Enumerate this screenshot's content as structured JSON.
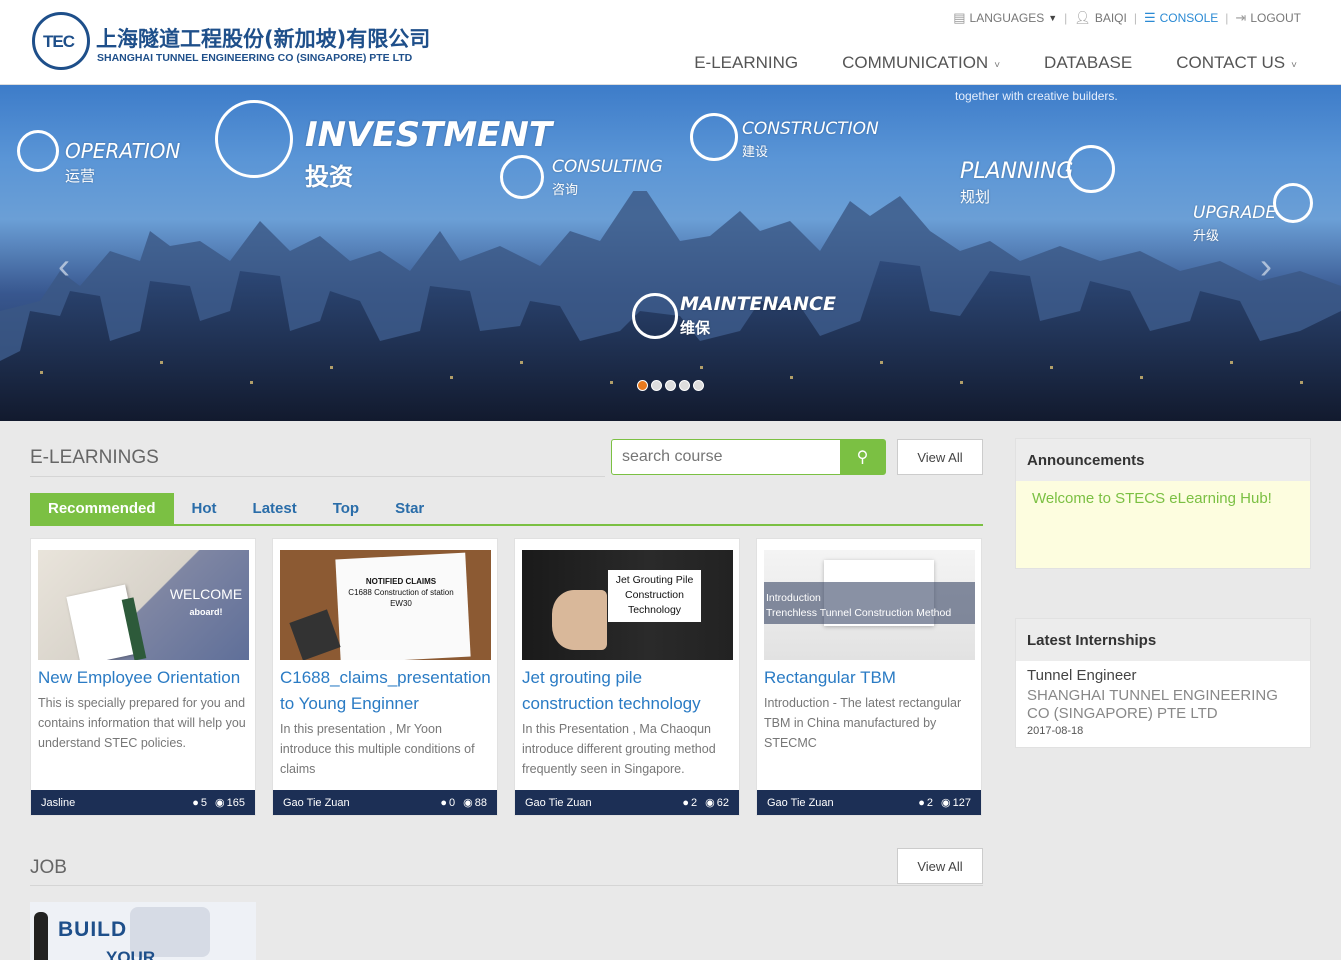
{
  "company": {
    "logo_mark": "TEC",
    "name_cn": "上海隧道工程股份(新加坡)有限公司",
    "name_en": "SHANGHAI TUNNEL ENGINEERING CO (SINGAPORE) PTE LTD"
  },
  "toplinks": {
    "languages": "LANGUAGES",
    "user": "BAIQI",
    "console": "CONSOLE",
    "logout": "LOGOUT"
  },
  "nav": [
    {
      "label": "E-LEARNING",
      "dropdown": false
    },
    {
      "label": "COMMUNICATION",
      "dropdown": true
    },
    {
      "label": "DATABASE",
      "dropdown": false
    },
    {
      "label": "CONTACT US",
      "dropdown": true
    }
  ],
  "hero": {
    "tagline": "together with creative builders.",
    "words": [
      {
        "en": "OPERATION",
        "cn": "运营"
      },
      {
        "en": "INVESTMENT",
        "cn": "投资"
      },
      {
        "en": "CONSULTING",
        "cn": "咨询"
      },
      {
        "en": "CONSTRUCTION",
        "cn": "建设"
      },
      {
        "en": "PLANNING",
        "cn": "规划"
      },
      {
        "en": "UPGRADE",
        "cn": "升级"
      },
      {
        "en": "MAINTENANCE",
        "cn": "维保"
      }
    ],
    "slide_count": 5,
    "active_slide": 1
  },
  "elearnings": {
    "title": "E-LEARNINGS",
    "search_placeholder": "search course",
    "view_all": "View All",
    "tabs": [
      "Recommended",
      "Hot",
      "Latest",
      "Top",
      "Star"
    ],
    "active_tab": "Recommended",
    "courses": [
      {
        "title": "New Employee Orientation",
        "thumb_text": "WELCOME",
        "thumb_sub": "aboard!",
        "description": "This is specially prepared for you and contains information that will help you understand STEC policies.",
        "author": "Jasline",
        "learners": "5",
        "views": "165"
      },
      {
        "title": "C1688_claims_presentation to Young Enginner",
        "thumb_text": "NOTIFIED CLAIMS",
        "thumb_sub": "C1688 Construction of station EW30",
        "description": "In this presentation , Mr Yoon introduce this multiple conditions of claims",
        "author": "Gao Tie Zuan",
        "learners": "0",
        "views": "88"
      },
      {
        "title": "Jet grouting pile construction technology",
        "thumb_text": "Jet Grouting Pile Construction Technology",
        "thumb_sub": "",
        "description": "In this Presentation , Ma Chaoqun introduce different grouting method frequently seen in Singapore.",
        "author": "Gao Tie Zuan",
        "learners": "2",
        "views": "62"
      },
      {
        "title": "Rectangular TBM",
        "thumb_text": "Introduction",
        "thumb_sub": "Trenchless Tunnel Construction Method",
        "description": "Introduction - The latest rectangular TBM in China manufactured by STECMC",
        "author": "Gao Tie Zuan",
        "learners": "2",
        "views": "127"
      }
    ]
  },
  "announcements": {
    "title": "Announcements",
    "text": "Welcome to STECS eLearning Hub!"
  },
  "internships": {
    "title": "Latest Internships",
    "items": [
      {
        "position": "Tunnel Engineer",
        "company": "SHANGHAI TUNNEL ENGINEERING CO (SINGAPORE) PTE LTD",
        "date": "2017-08-18"
      }
    ]
  },
  "job": {
    "title": "JOB",
    "view_all": "View All",
    "thumb_text": "BUILD",
    "thumb_sub": "YOUR"
  },
  "colors": {
    "accent_green": "#7bc043",
    "link_blue": "#2a7bc4",
    "brand_navy": "#1e4f8a",
    "card_footer": "#1c2f55",
    "active_dot": "#e87a1d"
  }
}
